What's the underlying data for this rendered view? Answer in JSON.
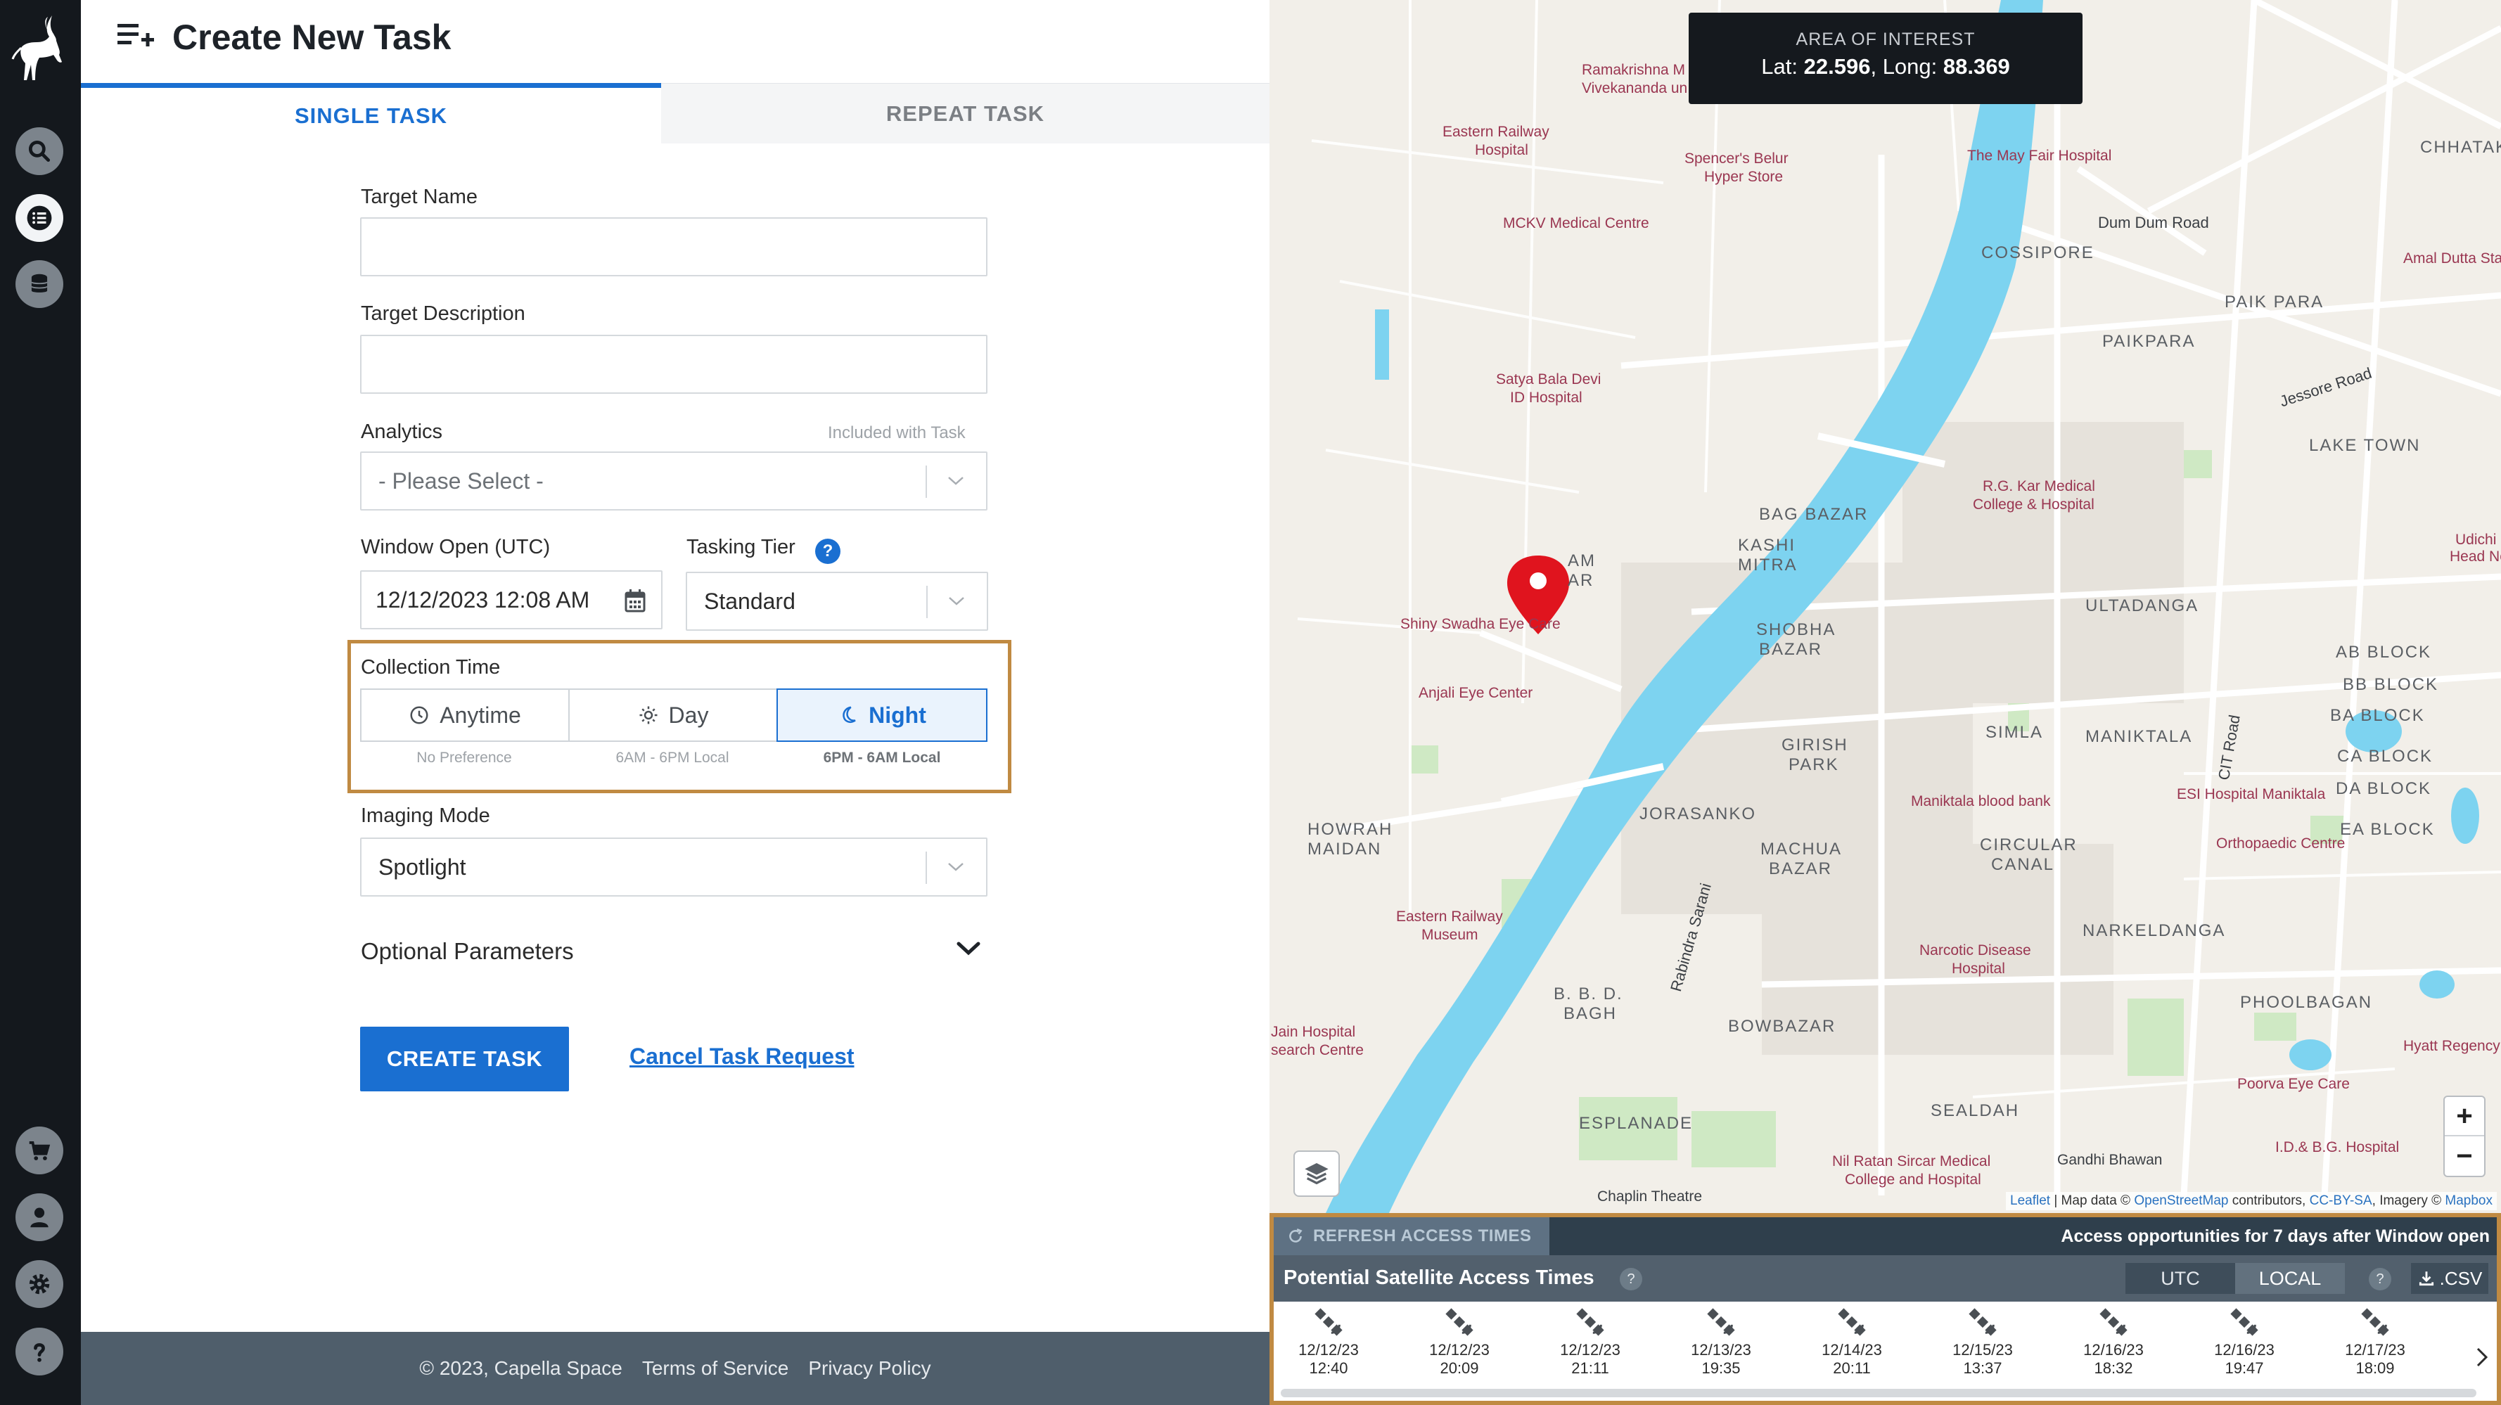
{
  "page": {
    "title": "Create New Task",
    "tabs": [
      {
        "label": "SINGLE TASK",
        "active": true
      },
      {
        "label": "REPEAT TASK",
        "active": false
      }
    ]
  },
  "form": {
    "target_name_label": "Target Name",
    "target_name_value": "",
    "target_description_label": "Target Description",
    "target_description_value": "",
    "analytics_label": "Analytics",
    "analytics_hint": "Included with Task",
    "analytics_value": "- Please Select -",
    "window_open_label": "Window Open (UTC)",
    "window_open_value": "12/12/2023 12:08 AM",
    "tasking_tier_label": "Tasking Tier",
    "tasking_tier_value": "Standard",
    "collection_time_label": "Collection Time",
    "collection_options": [
      {
        "label": "Anytime",
        "hint": "No Preference",
        "active": false
      },
      {
        "label": "Day",
        "hint": "6AM - 6PM Local",
        "active": false
      },
      {
        "label": "Night",
        "hint": "6PM - 6AM Local",
        "active": true
      }
    ],
    "imaging_mode_label": "Imaging Mode",
    "imaging_mode_value": "Spotlight",
    "optional_parameters_label": "Optional Parameters",
    "create_button": "CREATE TASK",
    "cancel_link": "Cancel Task Request",
    "help_glyph": "?"
  },
  "footer": {
    "copyright": "© 2023, Capella Space",
    "terms": "Terms of Service",
    "privacy": "Privacy Policy"
  },
  "map": {
    "aoi_title": "AREA OF INTEREST",
    "lat_label": "Lat:",
    "lat_value": "22.596",
    "long_label": "Long:",
    "long_value": "88.369",
    "zoom_in": "+",
    "zoom_out": "−",
    "attribution": {
      "leaflet": "Leaflet",
      "sep1": " | Map data © ",
      "osm": "OpenStreetMap",
      "contrib": " contributors, ",
      "license": "CC-BY-SA",
      "imagery": ", Imagery © ",
      "mapbox": "Mapbox"
    },
    "area_labels": [
      "COSSIPORE",
      "CHHATAKAL",
      "PAIK PARA",
      "PAIKPARA",
      "LAKE TOWN",
      "BAG BAZAR",
      "KASHI",
      "MITRA",
      "SHOBHA",
      "BAZAR",
      "ULTADANGA",
      "AB BLOCK",
      "BB BLOCK",
      "BA BLOCK",
      "CA BLOCK",
      "DA BLOCK",
      "EA BLOCK",
      "SIMLA",
      "MANIKTALA",
      "GIRISH",
      "PARK",
      "JORASANKO",
      "HOWRAH",
      "MAIDAN",
      "MACHUA",
      "BAZAR",
      "CIRCULAR",
      "CANAL",
      "NARKELDANGA",
      "B. B. D.",
      "BAGH",
      "BOWBAZAR",
      "PHOOLBAGAN",
      "SEALDAH",
      "ESPLANADE"
    ],
    "road_labels": [
      "Dum Dum Road",
      "Jessore Road",
      "CIT Road",
      "Rabindra Sarani"
    ],
    "poi_labels": [
      "Ramakrishna M",
      "Vivekananda un",
      "Eastern Railway",
      "Hospital",
      "Spencer's Belur",
      "Hyper Store",
      "MCKV Medical Centre",
      "The May Fair Hospital",
      "Amal Dutta Stad",
      "Satya Bala Devi",
      "ID Hospital",
      "R.G. Kar Medical",
      "College & Hospital",
      "Udichi EN",
      "Head Neck",
      "Shiny Swadha Eye Care",
      "Anjali Eye Center",
      "Maniktala blood bank",
      "ESI Hospital Maniktala",
      "Orthopaedic Centre",
      "Eastern Railway",
      "Museum",
      "Narcotic Disease",
      "Hospital",
      "Jain Hospital",
      "search Centre",
      "Poorva Eye Care",
      "Hyatt Regency",
      "Gandhi Bhawan",
      "I.D.& B.G. Hospital",
      "Nil Ratan Sircar Medical",
      "College and Hospital",
      "Chaplin Theatre",
      "AM",
      "AR"
    ]
  },
  "access": {
    "refresh_label": "REFRESH ACCESS TIMES",
    "note": "Access opportunities for 7 days after Window open",
    "title": "Potential Satellite Access Times",
    "tz_utc": "UTC",
    "tz_local": "LOCAL",
    "csv_label": ".CSV",
    "items": [
      {
        "date": "12/12/23",
        "time": "12:40"
      },
      {
        "date": "12/12/23",
        "time": "20:09"
      },
      {
        "date": "12/12/23",
        "time": "21:11"
      },
      {
        "date": "12/13/23",
        "time": "19:35"
      },
      {
        "date": "12/14/23",
        "time": "20:11"
      },
      {
        "date": "12/15/23",
        "time": "13:37"
      },
      {
        "date": "12/16/23",
        "time": "18:32"
      },
      {
        "date": "12/16/23",
        "time": "19:47"
      },
      {
        "date": "12/17/23",
        "time": "18:09"
      }
    ]
  },
  "colors": {
    "accent": "#1a6fd1",
    "highlight_border": "#c08a42",
    "sidebar": "#14181d",
    "water": "#7dd3f0",
    "marker": "#e0141e"
  }
}
